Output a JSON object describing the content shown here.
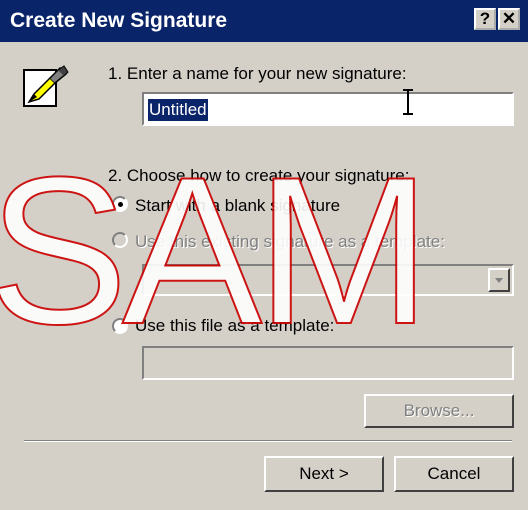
{
  "window": {
    "title": "Create New Signature"
  },
  "titlebar": {
    "help_label": "?",
    "close_label": "✕"
  },
  "step1": {
    "label": "1. Enter a name for your new signature:",
    "name_value": "Untitled"
  },
  "step2": {
    "label": "2. Choose how to create your signature:",
    "option_blank": "Start with a blank signature",
    "option_existing": "Use this existing signature as a template:",
    "existing_selected": "",
    "option_file": "Use this file as a template:",
    "file_value": "",
    "selected_option": "blank"
  },
  "buttons": {
    "browse": "Browse...",
    "next": "Next >",
    "cancel": "Cancel"
  },
  "watermark": "SAM",
  "icons": {
    "app": "signature-pen-icon",
    "cursor": "text-cursor-icon"
  }
}
